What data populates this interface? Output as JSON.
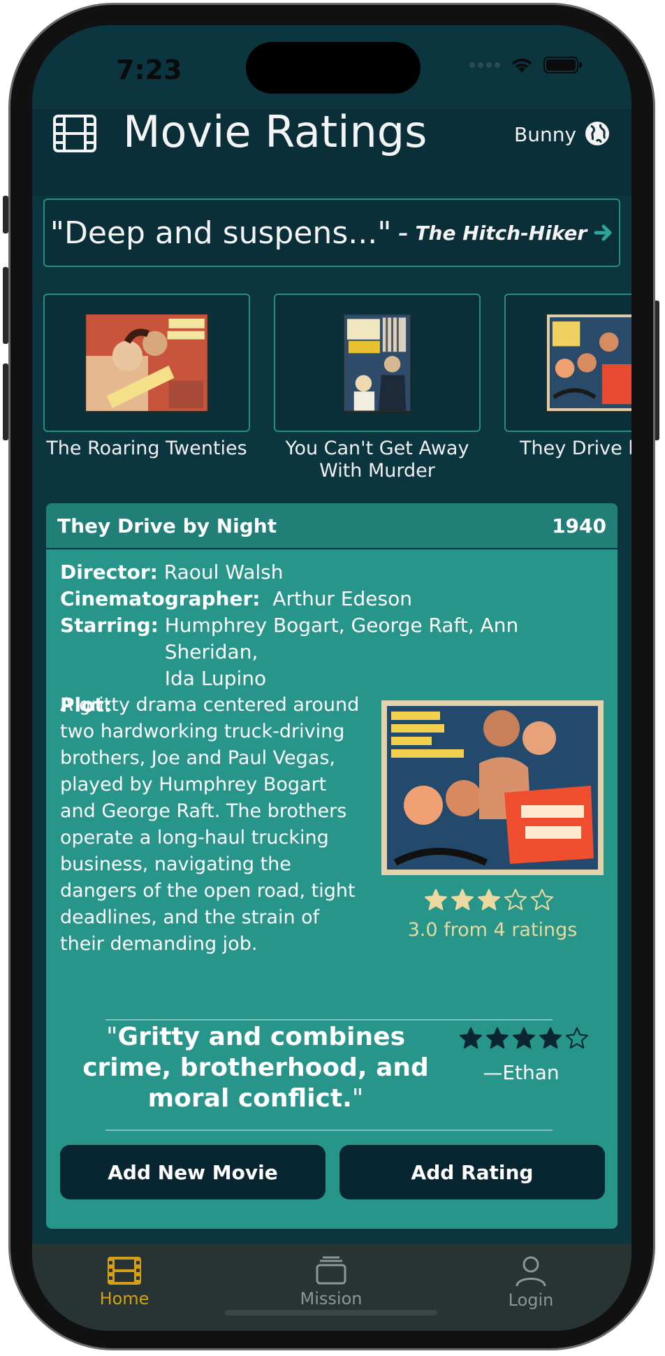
{
  "status": {
    "time": "7:23"
  },
  "header": {
    "title": "Movie Ratings",
    "user": "Bunny",
    "logo_icon": "film-icon",
    "globe_icon": "globe-icon"
  },
  "quote_banner": {
    "quote": "\"Deep and suspens...\"",
    "separator": "–",
    "movie": "The Hitch-Hiker"
  },
  "carousel": [
    {
      "title": "The Roaring Twenties"
    },
    {
      "title": "You Can't Get Away With Murder",
      "title_line1": "You Can't Get Away",
      "title_line2": "With Murder"
    },
    {
      "title": "They Drive by Night",
      "visible_text": "They Drive b"
    }
  ],
  "detail": {
    "title": "They Drive by Night",
    "year": "1940",
    "director_label": "Director:",
    "director": "Raoul Walsh",
    "cinematographer_label": "Cinematographer:",
    "cinematographer": "Arthur Edeson",
    "starring_label": "Starring:",
    "starring_line1": "Humphrey Bogart, George Raft, Ann Sheridan,",
    "starring_line2": "Ida Lupino",
    "plot_label": "Plot:",
    "plot": "A gritty drama centered around two hardworking truck-driving brothers, Joe and Paul Vegas, played by Humphrey Bogart and George Raft. The brothers operate a long-haul trucking business, navigating the dangers of the open road, tight deadlines, and the strain of their demanding job.",
    "rating_stars": 3,
    "rating_text": "3.0 from 4 ratings",
    "review_text": "Gritty and combines crime, brotherhood, and moral conflict.",
    "review_stars": 4,
    "reviewer": "—Ethan"
  },
  "actions": {
    "add_movie": "Add New Movie",
    "add_rating": "Add Rating"
  },
  "tabs": [
    {
      "label": "Home",
      "icon": "film-icon",
      "active": true
    },
    {
      "label": "Mission",
      "icon": "tray-stack-icon",
      "active": false
    },
    {
      "label": "Login",
      "icon": "person-icon",
      "active": false
    }
  ],
  "colors": {
    "accent": "#d4a017",
    "card": "#27958a",
    "header": "#0a2f38",
    "button": "#072632"
  }
}
